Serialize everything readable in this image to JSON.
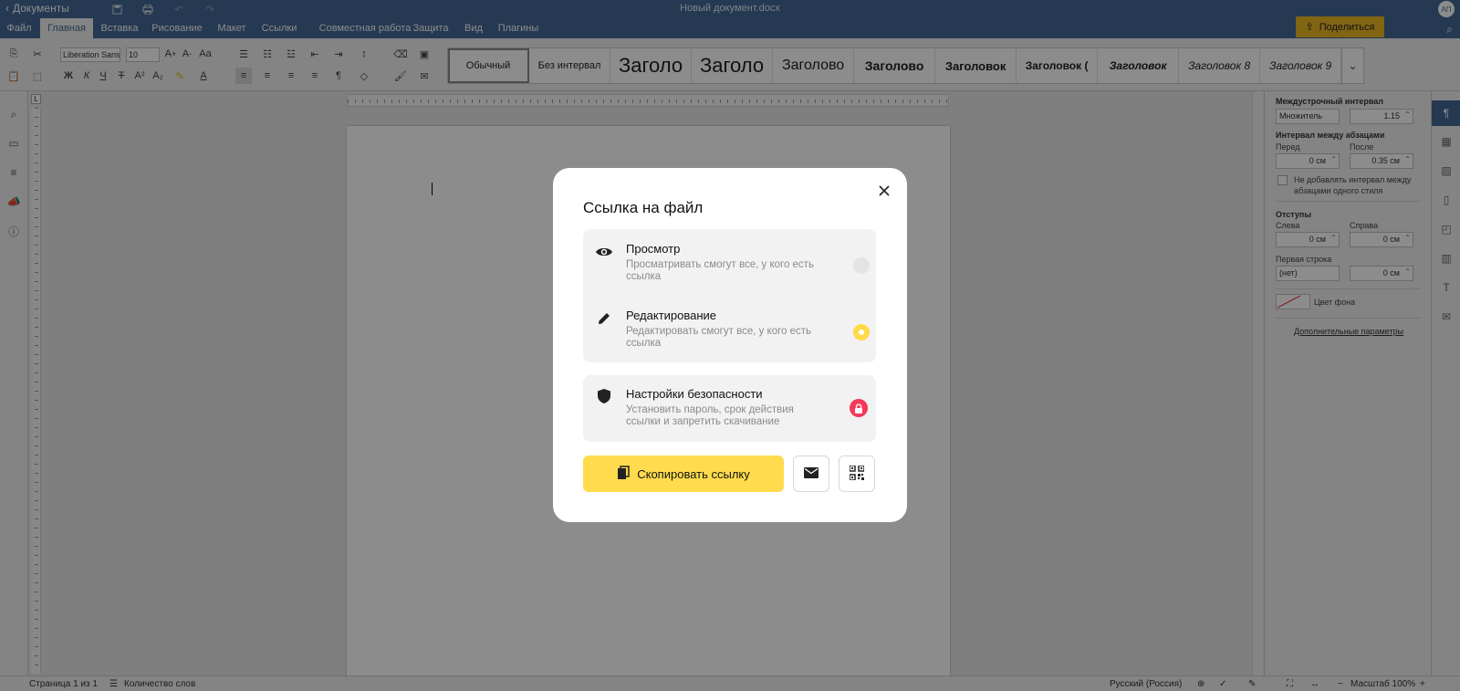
{
  "app": {
    "name": "Документы",
    "doc_title": "Новый документ.docx",
    "avatar": "АП"
  },
  "menu": {
    "tabs": [
      "Файл",
      "Главная",
      "Вставка",
      "Рисование",
      "Макет",
      "Ссылки",
      "Совместная работа",
      "Защита",
      "Вид",
      "Плагины"
    ],
    "active_tab": "Главная",
    "share_label": "Поделиться"
  },
  "toolbar": {
    "font_name": "Liberation Sans",
    "font_size": "10",
    "bold": "Ж",
    "italic": "К",
    "underline": "Ч",
    "strike": "Т"
  },
  "styles": [
    "Обычный",
    "Без интервал",
    "Заголо",
    "Заголо",
    "Заголово",
    "Заголово",
    "Заголовок",
    "Заголовок (",
    "Заголовок",
    "Заголовок 8",
    "Заголовок 9"
  ],
  "right_panel": {
    "line_spacing_title": "Междустрочный интервал",
    "line_spacing_mode": "Множитель",
    "line_spacing_value": "1.15",
    "para_spacing_title": "Интервал между абзацами",
    "before_label": "Перед",
    "after_label": "После",
    "before_value": "0 см",
    "after_value": "0.35 см",
    "no_spacing_label": "Не добавлять интервал между абзацами одного стиля",
    "indents_title": "Отступы",
    "left_label": "Слева",
    "right_label": "Справа",
    "left_value": "0 см",
    "right_value": "0 см",
    "first_line_label": "Первая строка",
    "first_line_mode": "(нет)",
    "first_line_value": "0 см",
    "bg_color_label": "Цвет фона",
    "advanced_label": "Дополнительные параметры"
  },
  "status": {
    "page": "Страница 1 из 1",
    "word_count": "Количество слов",
    "language": "Русский (Россия)",
    "zoom": "Масштаб 100%"
  },
  "modal": {
    "title": "Ссылка на файл",
    "view_title": "Просмотр",
    "view_desc": "Просматривать смогут все, у кого есть ссылка",
    "edit_title": "Редактирование",
    "edit_desc": "Редактировать смогут все, у кого есть ссылка",
    "selected": "edit",
    "security_title": "Настройки безопасности",
    "security_desc": "Установить пароль, срок действия ссылки и запретить скачивание",
    "copy_label": "Скопировать ссылку"
  },
  "colors": {
    "header": "#446995",
    "share": "#ecb924",
    "primary": "#ffdb4d",
    "lock": "#f33a5c"
  }
}
